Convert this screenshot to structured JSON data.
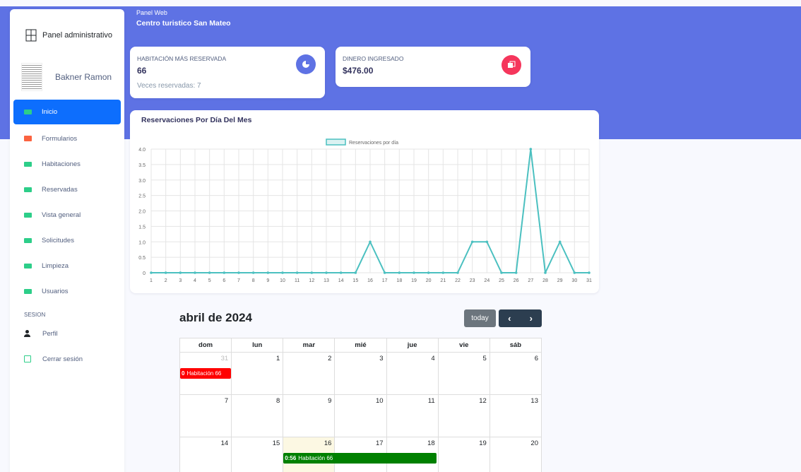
{
  "sidebar": {
    "brand": "Panel administrativo",
    "user": "Bakner Ramon",
    "items": [
      {
        "label": "Inicio"
      },
      {
        "label": "Formularios"
      },
      {
        "label": "Habitaciones"
      },
      {
        "label": "Reservadas"
      },
      {
        "label": "Vista general"
      },
      {
        "label": "Solicitudes"
      },
      {
        "label": "Limpieza"
      },
      {
        "label": "Usuarios"
      }
    ],
    "section": "SESION",
    "profile": "Perfil",
    "logout": "Cerrar sesión"
  },
  "header": {
    "subtitle": "Panel Web",
    "title": "Centro turistico San Mateo"
  },
  "stats": {
    "room": {
      "label": "HABITACIÓN MÁS RESERVADA",
      "value": "66",
      "sub": "Veces reservadas: 7"
    },
    "money": {
      "label": "DINERO INGRESADO",
      "value": "$476.00"
    }
  },
  "colors": {
    "primary": "#5e72e4",
    "line": "#4bc0c0",
    "event_red": "#ff0000",
    "event_green": "#008000"
  },
  "chart_data": {
    "type": "line",
    "title": "Reservaciones Por Día Del Mes",
    "series": [
      {
        "name": "Reservaciones por día",
        "values": [
          0,
          0,
          0,
          0,
          0,
          0,
          0,
          0,
          0,
          0,
          0,
          0,
          0,
          0,
          0,
          1,
          0,
          0,
          0,
          0,
          0,
          0,
          1,
          1,
          0,
          0,
          4,
          0,
          1,
          0,
          0
        ]
      }
    ],
    "categories": [
      "1",
      "2",
      "3",
      "4",
      "5",
      "6",
      "7",
      "8",
      "9",
      "10",
      "11",
      "12",
      "13",
      "14",
      "15",
      "16",
      "17",
      "18",
      "19",
      "20",
      "21",
      "22",
      "23",
      "24",
      "25",
      "26",
      "27",
      "28",
      "29",
      "30",
      "31"
    ],
    "yticks": [
      "0",
      "0.5",
      "1.0",
      "1.5",
      "2.0",
      "2.5",
      "3.0",
      "3.5",
      "4.0"
    ],
    "ylim": [
      0,
      4
    ],
    "grid": true,
    "legend": "top"
  },
  "calendar": {
    "title": "abril de 2024",
    "today_btn": "today",
    "prev": "‹",
    "next": "›",
    "weekdays": [
      "dom",
      "lun",
      "mar",
      "mié",
      "jue",
      "vie",
      "sáb"
    ],
    "weeks": [
      [
        "31",
        "1",
        "2",
        "3",
        "4",
        "5",
        "6"
      ],
      [
        "7",
        "8",
        "9",
        "10",
        "11",
        "12",
        "13"
      ],
      [
        "14",
        "15",
        "16",
        "17",
        "18",
        "19",
        "20"
      ]
    ],
    "events": [
      {
        "time": "0",
        "title": "Habitación 66"
      },
      {
        "time": "0:56",
        "title": "Habitación 66"
      }
    ]
  }
}
